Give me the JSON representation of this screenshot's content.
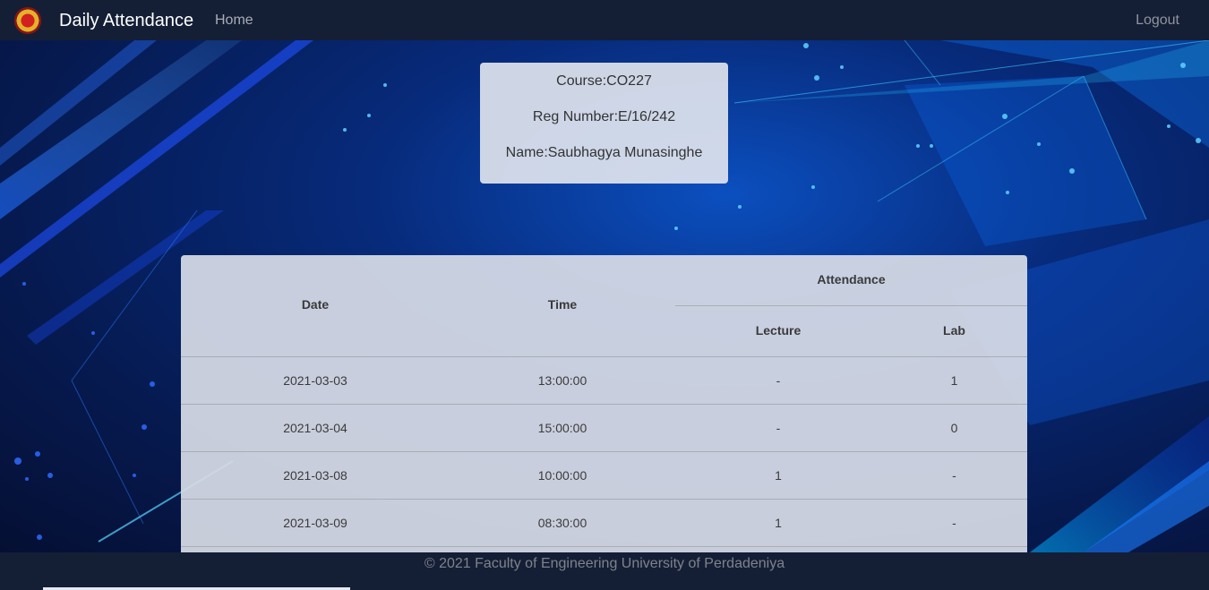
{
  "navbar": {
    "brand": "Daily Attendance",
    "home_label": "Home",
    "logout_label": "Logout"
  },
  "info": {
    "course": "Course:CO227",
    "reg_number": "Reg Number:E/16/242",
    "name": "Name:Saubhagya Munasinghe"
  },
  "table": {
    "headers": {
      "date": "Date",
      "time": "Time",
      "attendance": "Attendance",
      "lecture": "Lecture",
      "lab": "Lab"
    },
    "rows": [
      {
        "date": "2021-03-03",
        "time": "13:00:00",
        "lecture": "-",
        "lab": "1"
      },
      {
        "date": "2021-03-04",
        "time": "15:00:00",
        "lecture": "-",
        "lab": "0"
      },
      {
        "date": "2021-03-08",
        "time": "10:00:00",
        "lecture": "1",
        "lab": "-"
      },
      {
        "date": "2021-03-09",
        "time": "08:30:00",
        "lecture": "1",
        "lab": "-"
      }
    ]
  },
  "footer": {
    "text": "© 2021 Faculty of Engineering University of Perdadeniya"
  },
  "colors": {
    "navbar": "#141f36",
    "background_blue": "#072a7a",
    "card": "#e4e8f0"
  }
}
